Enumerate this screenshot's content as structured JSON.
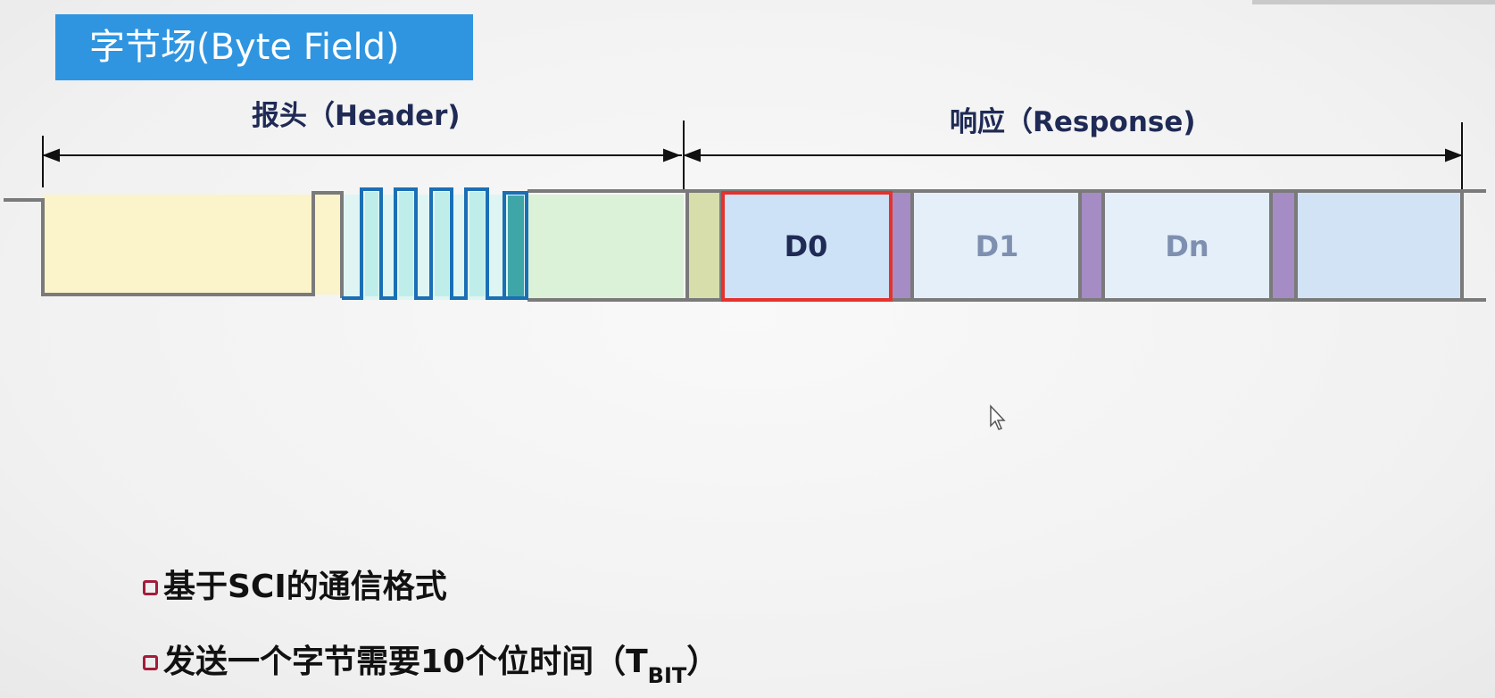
{
  "title": "字节场(Byte Field)",
  "header_label": "报头（Header)",
  "response_label": "响应（Response)",
  "bytes": {
    "d0": "D0",
    "d1": "D1",
    "dn": "Dn"
  },
  "bullets": {
    "line1": "基于SCI的通信格式",
    "line2_prefix": "发送一个字节需要10个位时间（T",
    "line2_sub": "BIT",
    "line2_suffix": "）"
  },
  "colors": {
    "title_bg": "#2f95e0",
    "highlight_border": "#e5322d",
    "bullet_icon": "#a31c3a",
    "sync_pulse": "#1a6fb5"
  },
  "icons": {
    "cursor": "mouse-pointer-icon",
    "bullet": "checkbox-icon"
  }
}
